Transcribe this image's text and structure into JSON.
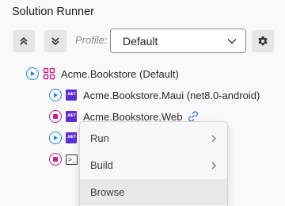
{
  "panel": {
    "title": "Solution Runner"
  },
  "toolbar": {
    "collapse_icon": "chevrons-up-icon",
    "expand_icon": "chevrons-down-icon",
    "profile_label": "Profile:",
    "profile_value": "Default",
    "settings_icon": "gear-icon"
  },
  "tree": {
    "solution": {
      "label": "Acme.Bookstore (Default)",
      "state": "stopped"
    },
    "projects": [
      {
        "label": "Acme.Bookstore.Maui (net8.0-android)",
        "state": "stopped",
        "kind": ".NET"
      },
      {
        "label": "Acme.Bookstore.Web",
        "state": "running",
        "kind": ".NET",
        "link_icon": "link-icon"
      },
      {
        "label": "",
        "state": "stopped",
        "kind": ".NET"
      },
      {
        "label": "",
        "state": "running",
        "kind": "console"
      }
    ],
    "net_badge": ".NET"
  },
  "context_menu": {
    "items": [
      {
        "label": "Run",
        "submenu": true
      },
      {
        "label": "Build",
        "submenu": true
      },
      {
        "label": "Browse",
        "submenu": false,
        "highlighted": true
      }
    ]
  },
  "colors": {
    "play": "#1a8cd8",
    "stop": "#c3208a",
    "dotnet": "#5c2fd6",
    "link": "#2f7fd8"
  }
}
